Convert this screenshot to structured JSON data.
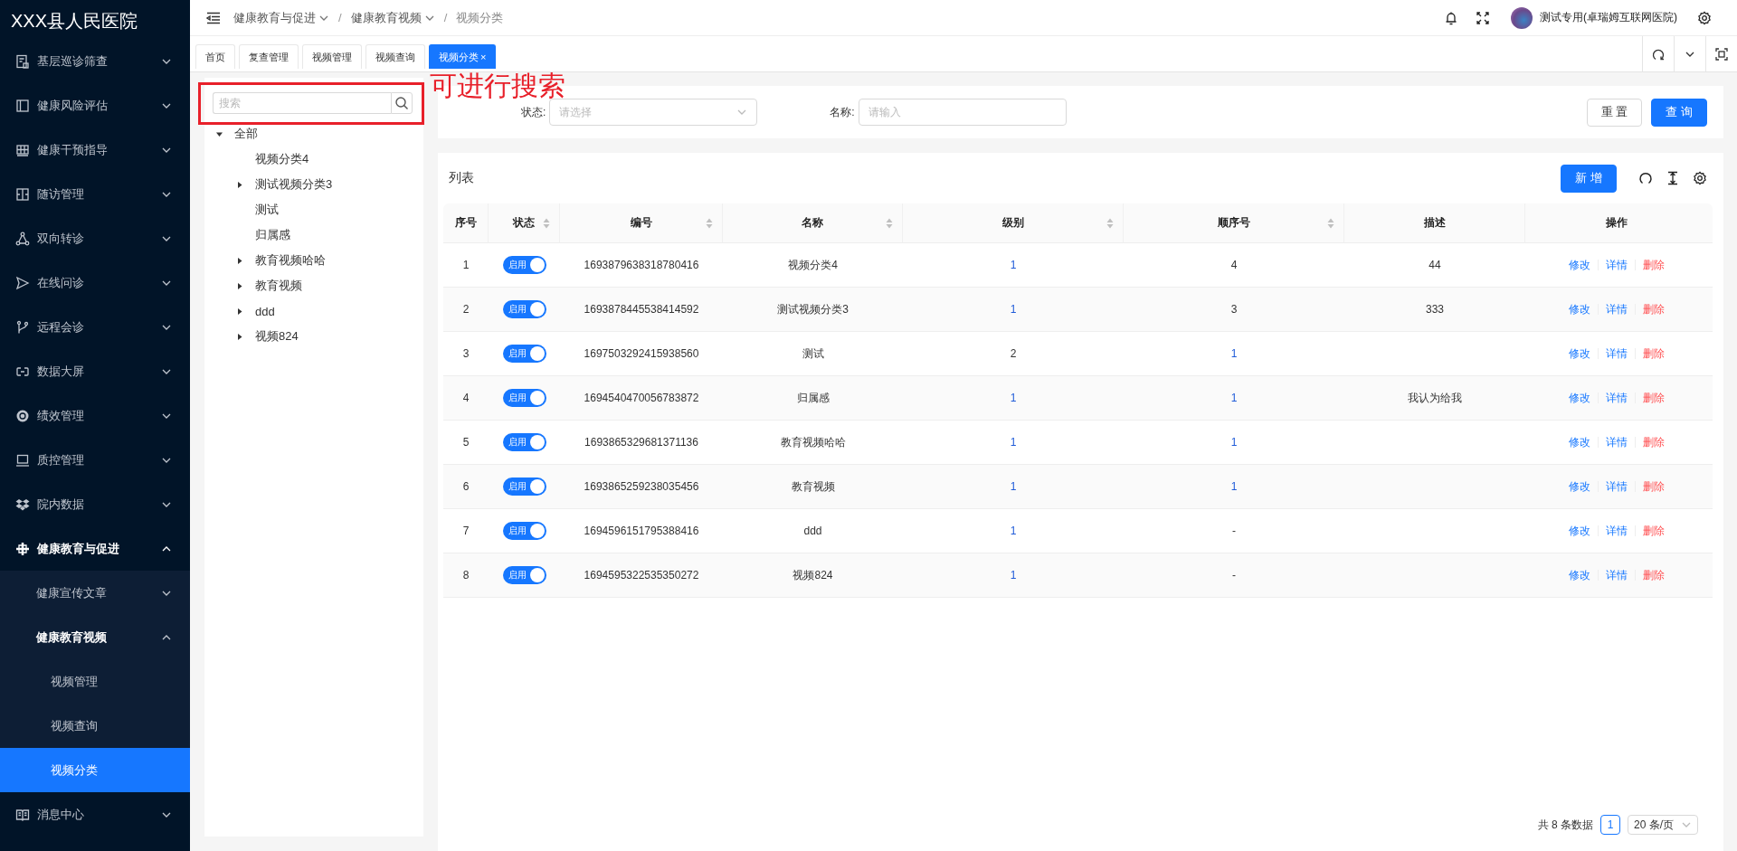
{
  "sidebar": {
    "logo": "XXX县人民医院",
    "items": [
      {
        "label": "基层巡诊筛查",
        "expanded": false
      },
      {
        "label": "健康风险评估",
        "expanded": false
      },
      {
        "label": "健康干预指导",
        "expanded": false
      },
      {
        "label": "随访管理",
        "expanded": false
      },
      {
        "label": "双向转诊",
        "expanded": false
      },
      {
        "label": "在线问诊",
        "expanded": false
      },
      {
        "label": "远程会诊",
        "expanded": false
      },
      {
        "label": "数据大屏",
        "expanded": false
      },
      {
        "label": "绩效管理",
        "expanded": false
      },
      {
        "label": "质控管理",
        "expanded": false
      },
      {
        "label": "院内数据",
        "expanded": false
      },
      {
        "label": "健康教育与促进",
        "expanded": true,
        "children": [
          {
            "label": "健康宣传文章",
            "expanded": false
          },
          {
            "label": "健康教育视频",
            "expanded": true,
            "children": [
              {
                "label": "视频管理",
                "selected": false
              },
              {
                "label": "视频查询",
                "selected": false
              },
              {
                "label": "视频分类",
                "selected": true
              }
            ]
          }
        ]
      },
      {
        "label": "消息中心",
        "expanded": false
      }
    ]
  },
  "header": {
    "breadcrumb": [
      {
        "label": "健康教育与促进",
        "has_menu": true
      },
      {
        "label": "健康教育视频",
        "has_menu": true
      },
      {
        "label": "视频分类",
        "has_menu": false
      }
    ],
    "separator": "/",
    "user": "测试专用(卓瑞姆互联网医院)"
  },
  "tabs": [
    {
      "label": "首页",
      "selected": false
    },
    {
      "label": "复查管理",
      "selected": false
    },
    {
      "label": "视频管理",
      "selected": false
    },
    {
      "label": "视频查询",
      "selected": false
    },
    {
      "label": "视频分类",
      "selected": true,
      "close": "×"
    }
  ],
  "tree": {
    "search_placeholder": "搜索",
    "root": {
      "label": "全部",
      "expanded": true,
      "children": [
        {
          "label": "视频分类4",
          "kind": "leaf"
        },
        {
          "label": "测试视频分类3",
          "kind": "branch"
        },
        {
          "label": "测试",
          "kind": "leaf"
        },
        {
          "label": "归属感",
          "kind": "leaf"
        },
        {
          "label": "教育视频哈哈",
          "kind": "branch"
        },
        {
          "label": "教育视频",
          "kind": "branch"
        },
        {
          "label": "ddd",
          "kind": "branch"
        },
        {
          "label": "视频824",
          "kind": "branch"
        }
      ]
    }
  },
  "annotation": {
    "text": "可进行搜索"
  },
  "filters": [
    {
      "label": "状态:",
      "placeholder": "请选择",
      "kind": "select"
    },
    {
      "label": "名称:",
      "placeholder": "请输入",
      "kind": "input"
    }
  ],
  "filter_buttons": [
    {
      "label": "重 置",
      "kind": "default"
    },
    {
      "label": "查 询",
      "kind": "primary"
    }
  ],
  "table": {
    "title": "列表",
    "add_button": "新 增",
    "columns": [
      {
        "label": "序号",
        "sortable": false
      },
      {
        "label": "状态",
        "sortable": true
      },
      {
        "label": "编号",
        "sortable": true
      },
      {
        "label": "名称",
        "sortable": true
      },
      {
        "label": "级别",
        "sortable": true
      },
      {
        "label": "顺序号",
        "sortable": true
      },
      {
        "label": "描述",
        "sortable": false
      },
      {
        "label": "操作",
        "sortable": false
      }
    ],
    "rows": [
      {
        "index": "1",
        "status": {
          "text": "启用",
          "on": true
        },
        "code": "1693879638318780416",
        "name": "视频分类4",
        "level": {
          "text": "1",
          "link": true
        },
        "order": {
          "text": "4",
          "link": false
        },
        "description": "44",
        "actions": [
          {
            "text": "修改",
            "kind": "link"
          },
          {
            "text": "详情",
            "kind": "link"
          },
          {
            "text": "删除",
            "kind": "danger"
          }
        ]
      },
      {
        "index": "2",
        "status": {
          "text": "启用",
          "on": true
        },
        "code": "1693878445538414592",
        "name": "测试视频分类3",
        "level": {
          "text": "1",
          "link": true
        },
        "order": {
          "text": "3",
          "link": false
        },
        "description": "333",
        "actions": [
          {
            "text": "修改",
            "kind": "link"
          },
          {
            "text": "详情",
            "kind": "link"
          },
          {
            "text": "删除",
            "kind": "danger"
          }
        ]
      },
      {
        "index": "3",
        "status": {
          "text": "启用",
          "on": true
        },
        "code": "1697503292415938560",
        "name": "测试",
        "level": {
          "text": "2",
          "link": false
        },
        "order": {
          "text": "1",
          "link": true
        },
        "actions": [
          {
            "text": "修改",
            "kind": "link"
          },
          {
            "text": "详情",
            "kind": "link"
          },
          {
            "text": "删除",
            "kind": "danger"
          }
        ]
      },
      {
        "index": "4",
        "status": {
          "text": "启用",
          "on": true
        },
        "code": "1694540470056783872",
        "name": "归属感",
        "level": {
          "text": "1",
          "link": true
        },
        "order": {
          "text": "1",
          "link": true
        },
        "description": "我认为给我",
        "actions": [
          {
            "text": "修改",
            "kind": "link"
          },
          {
            "text": "详情",
            "kind": "link"
          },
          {
            "text": "删除",
            "kind": "danger"
          }
        ]
      },
      {
        "index": "5",
        "status": {
          "text": "启用",
          "on": true
        },
        "code": "1693865329681371136",
        "name": "教育视频哈哈",
        "level": {
          "text": "1",
          "link": true
        },
        "order": {
          "text": "1",
          "link": true
        },
        "actions": [
          {
            "text": "修改",
            "kind": "link"
          },
          {
            "text": "详情",
            "kind": "link"
          },
          {
            "text": "删除",
            "kind": "danger"
          }
        ]
      },
      {
        "index": "6",
        "status": {
          "text": "启用",
          "on": true
        },
        "code": "1693865259238035456",
        "name": "教育视频",
        "level": {
          "text": "1",
          "link": true
        },
        "order": {
          "text": "1",
          "link": true
        },
        "actions": [
          {
            "text": "修改",
            "kind": "link"
          },
          {
            "text": "详情",
            "kind": "link"
          },
          {
            "text": "删除",
            "kind": "danger"
          }
        ]
      },
      {
        "index": "7",
        "status": {
          "text": "启用",
          "on": true
        },
        "code": "1694596151795388416",
        "name": "ddd",
        "level": {
          "text": "1",
          "link": true
        },
        "order": {
          "text": "-",
          "link": false
        },
        "actions": [
          {
            "text": "修改",
            "kind": "link"
          },
          {
            "text": "详情",
            "kind": "link"
          },
          {
            "text": "删除",
            "kind": "danger"
          }
        ]
      },
      {
        "index": "8",
        "status": {
          "text": "启用",
          "on": true
        },
        "code": "1694595322535350272",
        "name": "视频824",
        "level": {
          "text": "1",
          "link": true
        },
        "order": {
          "text": "-",
          "link": false
        },
        "actions": [
          {
            "text": "修改",
            "kind": "link"
          },
          {
            "text": "详情",
            "kind": "link"
          },
          {
            "text": "删除",
            "kind": "danger"
          }
        ]
      }
    ]
  },
  "pagination": {
    "total": "共 8 条数据",
    "page": "1",
    "page_size": "20 条/页"
  }
}
